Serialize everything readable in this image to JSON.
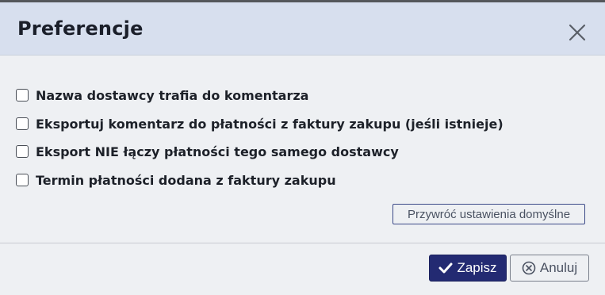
{
  "dialog": {
    "title": "Preferencje",
    "close_icon": "close-x-icon"
  },
  "options": [
    {
      "label": "Nazwa dostawcy trafia do komentarza",
      "checked": false
    },
    {
      "label": "Eksportuj komentarz do płatności z faktury zakupu (jeśli istnieje)",
      "checked": false
    },
    {
      "label": "Eksport NIE łączy płatności tego samego dostawcy",
      "checked": false
    },
    {
      "label": "Termin płatności dodana z faktury zakupu",
      "checked": false
    }
  ],
  "reset_button": {
    "label": "Przywróć ustawienia domyślne"
  },
  "footer": {
    "save_label": "Zapisz",
    "save_icon": "check-icon",
    "cancel_label": "Anuluj",
    "cancel_icon": "circle-x-icon"
  },
  "colors": {
    "header_bg": "#d7dfee",
    "body_bg": "#eef0f3",
    "primary": "#232a72"
  }
}
